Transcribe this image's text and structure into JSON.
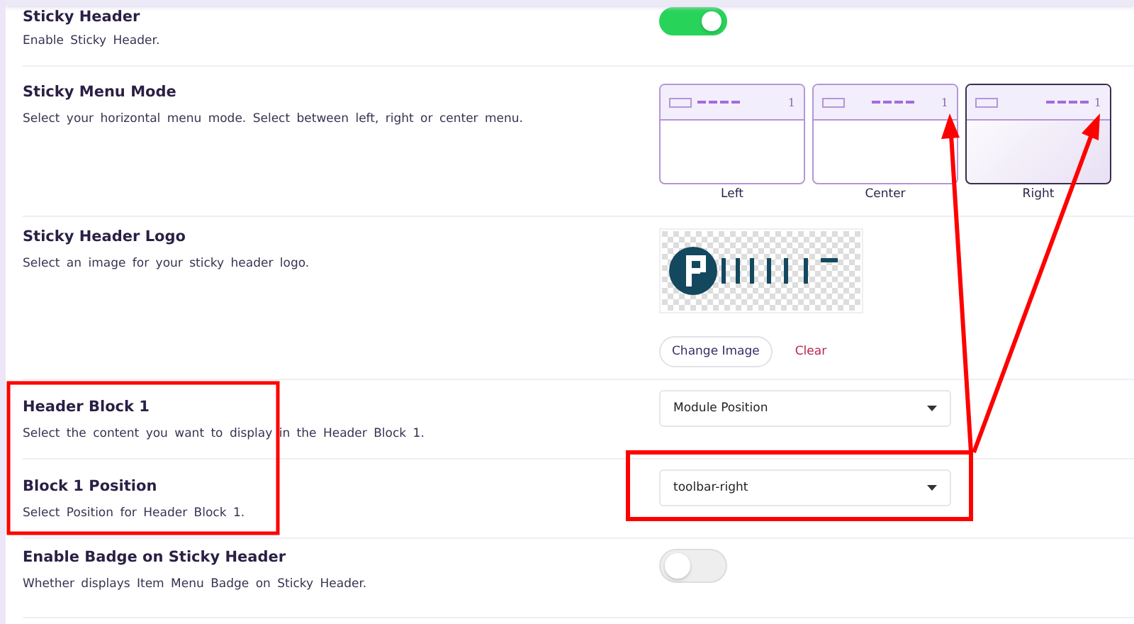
{
  "settings": [
    {
      "kind": "toggle",
      "title": "Sticky Header",
      "description": "Enable Sticky Header.",
      "on": true
    },
    {
      "kind": "modes",
      "title": "Sticky Menu Mode",
      "description": "Select your horizontal menu mode. Select between left, right or center menu.",
      "options": [
        {
          "label": "Left",
          "badge": "1",
          "kind": "left",
          "selected": false
        },
        {
          "label": "Center",
          "badge": "1",
          "kind": "center",
          "selected": false
        },
        {
          "label": "Right",
          "badge": "1",
          "kind": "right",
          "selected": true
        }
      ]
    },
    {
      "title": "Sticky Header Logo",
      "description": "Select an image for your sticky header logo.",
      "change_button": "Change Image",
      "clear_button": "Clear"
    },
    {
      "kind": "select",
      "title": "Header Block 1",
      "description": "Select the content you want to display in the Header Block 1.",
      "value": "Module Position"
    },
    {
      "kind": "select",
      "title": "Block 1 Position",
      "description": "Select Position for Header Block 1.",
      "value": "toolbar-right"
    },
    {
      "kind": "toggle",
      "title": "Enable Badge on Sticky Header",
      "description": "Whether displays Item Menu Badge on Sticky Header.",
      "on": false
    }
  ]
}
